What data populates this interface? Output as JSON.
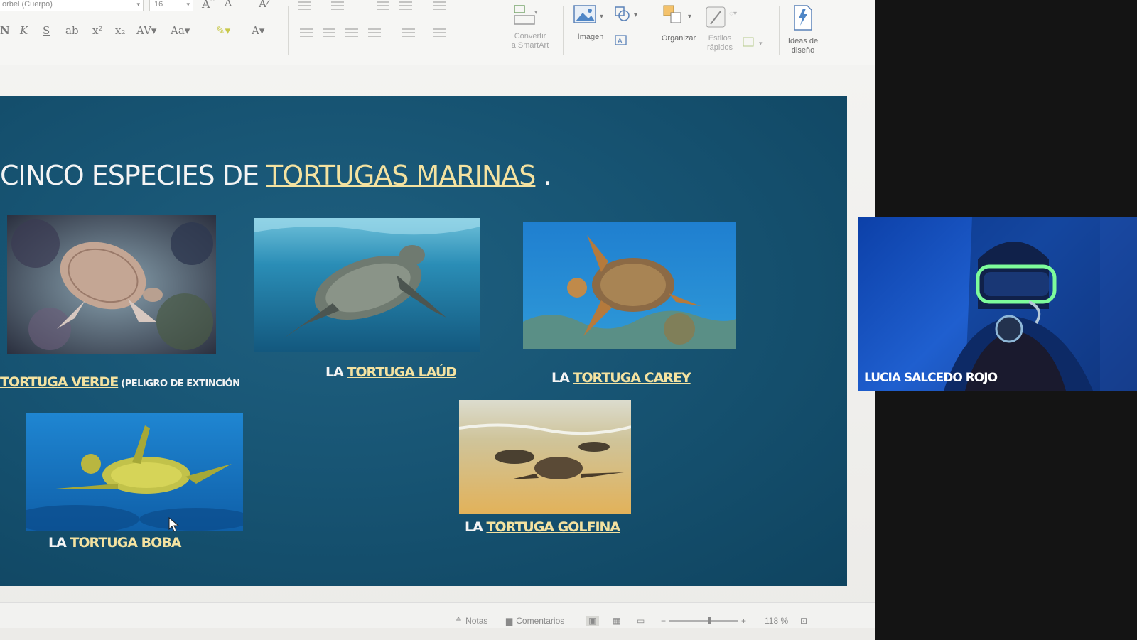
{
  "ribbon": {
    "font_name": "orbel (Cuerpo)",
    "font_size": "16",
    "convert_smartart": "Convertir\na SmartArt",
    "image_label": "Imagen",
    "arrange_label": "Organizar",
    "quick_styles_label": "Estilos\nrápidos",
    "design_ideas_label": "Ideas de\ndiseño"
  },
  "slide": {
    "title_prefix": "CINCO ESPECIES DE ",
    "title_link": "TORTUGAS MARINAS",
    "title_suffix": " .",
    "turtles": [
      {
        "prefix": "",
        "link": "TORTUGA VERDE",
        "note": " (PELIGRO DE EXTINCIÓN"
      },
      {
        "prefix": "LA ",
        "link": "TORTUGA LAÚD"
      },
      {
        "prefix": "LA ",
        "link": "TORTUGA CAREY"
      },
      {
        "prefix": "LA ",
        "link": "TORTUGA BOBA"
      },
      {
        "prefix": "LA ",
        "link": "TORTUGA GOLFINA"
      }
    ]
  },
  "statusbar": {
    "notes_label": "Notas",
    "comments_label": "Comentarios",
    "zoom": "118 %"
  },
  "video": {
    "participant_name": "LUCIA SALCEDO ROJO"
  },
  "colors": {
    "slide_bg": "#175473",
    "title_text": "#f4f4f4",
    "link_text": "#f4e2a0",
    "video_bg": "#1f5fcf"
  }
}
